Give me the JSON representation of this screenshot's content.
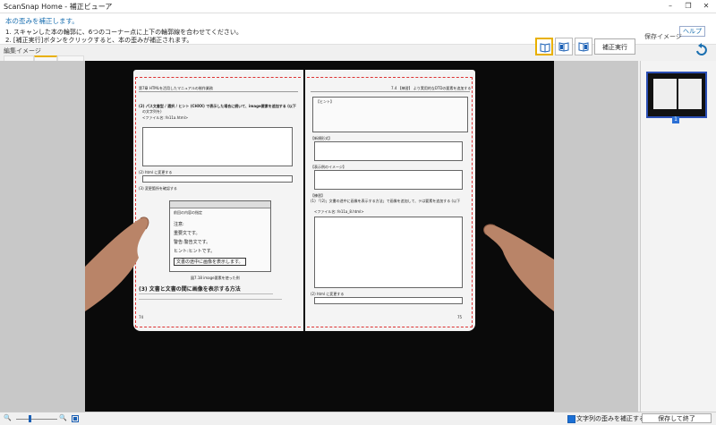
{
  "window": {
    "title": "ScanSnap Home - 補正ビューア",
    "minimize": "–",
    "restore": "❐",
    "close": "✕"
  },
  "instructions": {
    "heading": "本の歪みを補正します。",
    "line1": "1. スキャンした本の輪郭に、6つのコーナー点に上下の輪郭線を合わせてください。",
    "line2": "2. [補正実行]ボタンをクリックすると、本の歪みが補正されます。",
    "help": "ヘルプ"
  },
  "labels": {
    "edit_image": "編集イメージ",
    "saved_image": "保存イメージ"
  },
  "toolbar": {
    "apply": "補正実行"
  },
  "book": {
    "left": {
      "header": "第7章 HTMLを活用したマニュアルの制作業務",
      "section1": "(2) パス文書型 / 選択 / ヒント (CHXX) で表示した場合に続いて、image要素を追加する (以下",
      "sub1": "の文字列を)",
      "file1": "<ファイル名: fe11a.html>",
      "step2": "(2) html に変更する",
      "step3": "(3) 変更箇所を確認する",
      "dialog_title": "前回の内容の指定",
      "dialog_l1": "注意:",
      "dialog_l2": "重要文です。",
      "dialog_l3": "警告:警告文です。",
      "dialog_l4": "ヒント:ヒントです。",
      "dialog_l5": "文書の途中に画像を表示します。",
      "caption": "図7.18 image要素を使った例",
      "section2": "(3) 文書と文書の間に画像を表示する方法",
      "page_no": "74"
    },
    "right": {
      "header": "7.4 【練習】 より実用的なDTDの要素を追加する",
      "hint_title": "【ヒント】",
      "basic": "【新規形式】",
      "display": "【表示例のイメージ】",
      "practice": "【練習】",
      "practice_l1": "(1) 「(2)」文書の途中に画像を表示する方法」で画像を追加して、テは要素を追加する (以下",
      "file2": "<ファイル名: fe11a_8.html>",
      "step2": "(2) html に変更する",
      "page_no": "75"
    }
  },
  "thumbnail": {
    "index": "1"
  },
  "status": {
    "zoom_out": "🔍",
    "zoom_in": "🔍",
    "checkbox_label": "文字列の歪みを補正する",
    "save_exit": "保存して終了"
  }
}
